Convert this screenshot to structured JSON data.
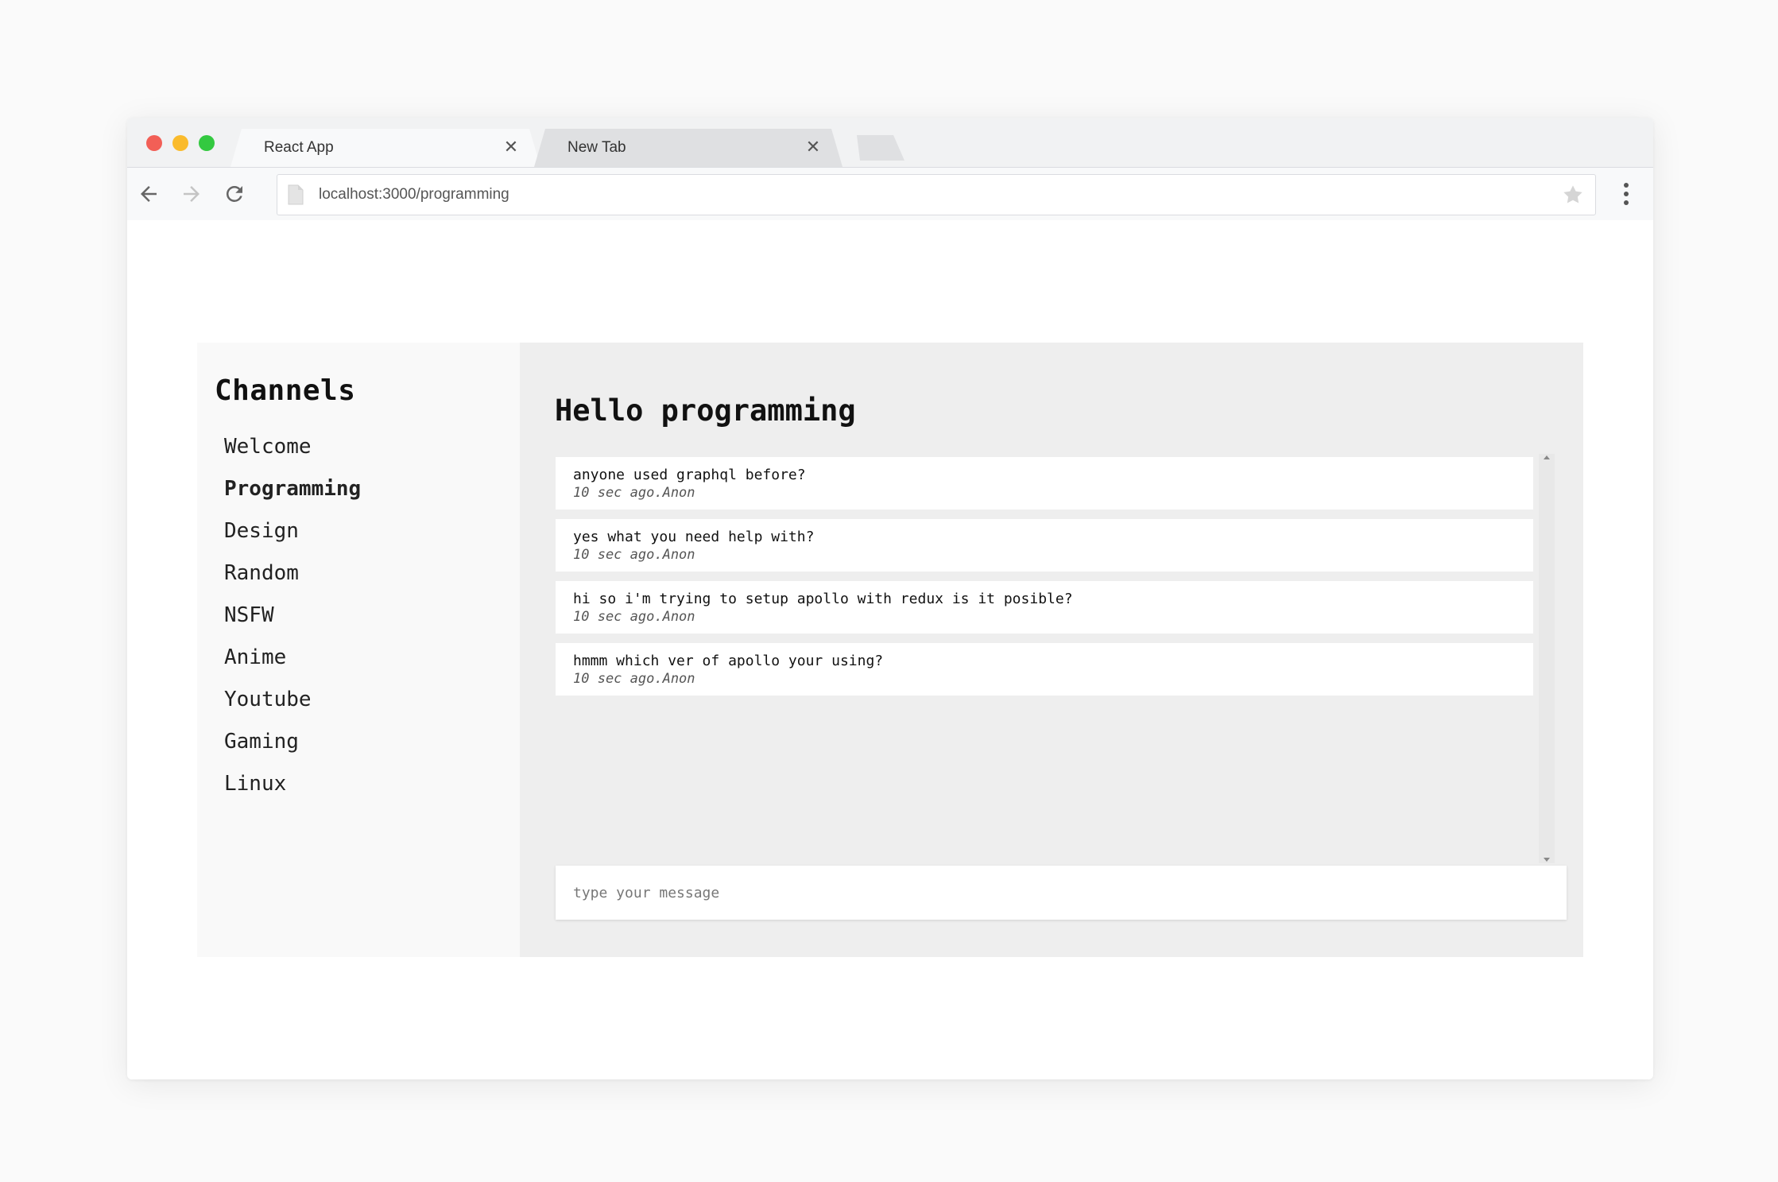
{
  "browser": {
    "tabs": [
      {
        "title": "React App",
        "active": true
      },
      {
        "title": "New Tab",
        "active": false
      }
    ],
    "url": "localhost:3000/programming"
  },
  "sidebar": {
    "title": "Channels",
    "channels": [
      {
        "label": "Welcome"
      },
      {
        "label": "Programming",
        "active": true
      },
      {
        "label": "Design"
      },
      {
        "label": "Random"
      },
      {
        "label": "NSFW"
      },
      {
        "label": "Anime"
      },
      {
        "label": "Youtube"
      },
      {
        "label": "Gaming"
      },
      {
        "label": "Linux"
      }
    ]
  },
  "main": {
    "heading": "Hello programming",
    "messages": [
      {
        "text": "anyone used graphql before?",
        "meta": "10 sec ago.Anon"
      },
      {
        "text": "yes what you need help with?",
        "meta": "10 sec ago.Anon"
      },
      {
        "text": "hi so i'm trying to setup apollo with redux is it posible?",
        "meta": "10 sec ago.Anon"
      },
      {
        "text": "hmmm which ver of apollo your using?",
        "meta": "10 sec ago.Anon"
      }
    ],
    "composer_placeholder": "type your message"
  },
  "colors": {
    "traffic_red": "#f25f56",
    "traffic_yellow": "#fabb2c",
    "traffic_green": "#33c940",
    "chat_background": "#eeeeee",
    "sidebar_background": "#f9f9f9"
  }
}
